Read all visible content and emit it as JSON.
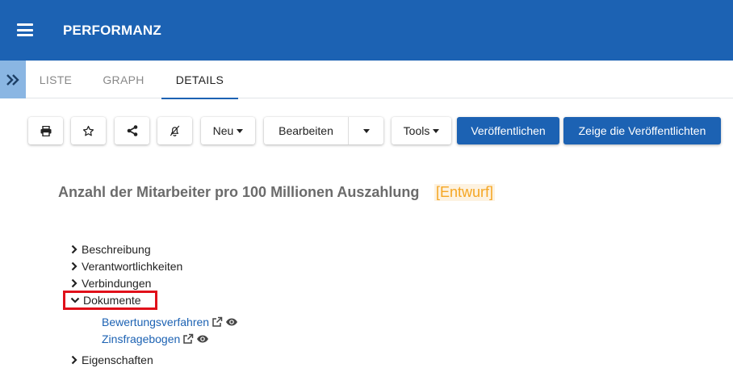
{
  "app": {
    "title": "PERFORMANZ"
  },
  "tabs": [
    {
      "label": "LISTE"
    },
    {
      "label": "GRAPH"
    },
    {
      "label": "DETAILS"
    }
  ],
  "toolbar": {
    "new_label": "Neu",
    "edit_label": "Bearbeiten",
    "tools_label": "Tools",
    "publish_label": "Veröffentlichen",
    "show_published_label": "Zeige die Veröffentlichten"
  },
  "page": {
    "title": "Anzahl der Mitarbeiter pro 100 Millionen Auszahlung",
    "status": "[Entwurf]"
  },
  "tree": {
    "description": "Beschreibung",
    "responsibilities": "Verantwortlichkeiten",
    "connections": "Verbindungen",
    "documents": "Dokumente",
    "documents_items": [
      {
        "label": "Bewertungsverfahren"
      },
      {
        "label": "Zinsfragebogen"
      }
    ],
    "properties": "Eigenschaften"
  },
  "colors": {
    "primary": "#1c62b3",
    "status": "#f5a623",
    "highlight": "#e0101a"
  }
}
